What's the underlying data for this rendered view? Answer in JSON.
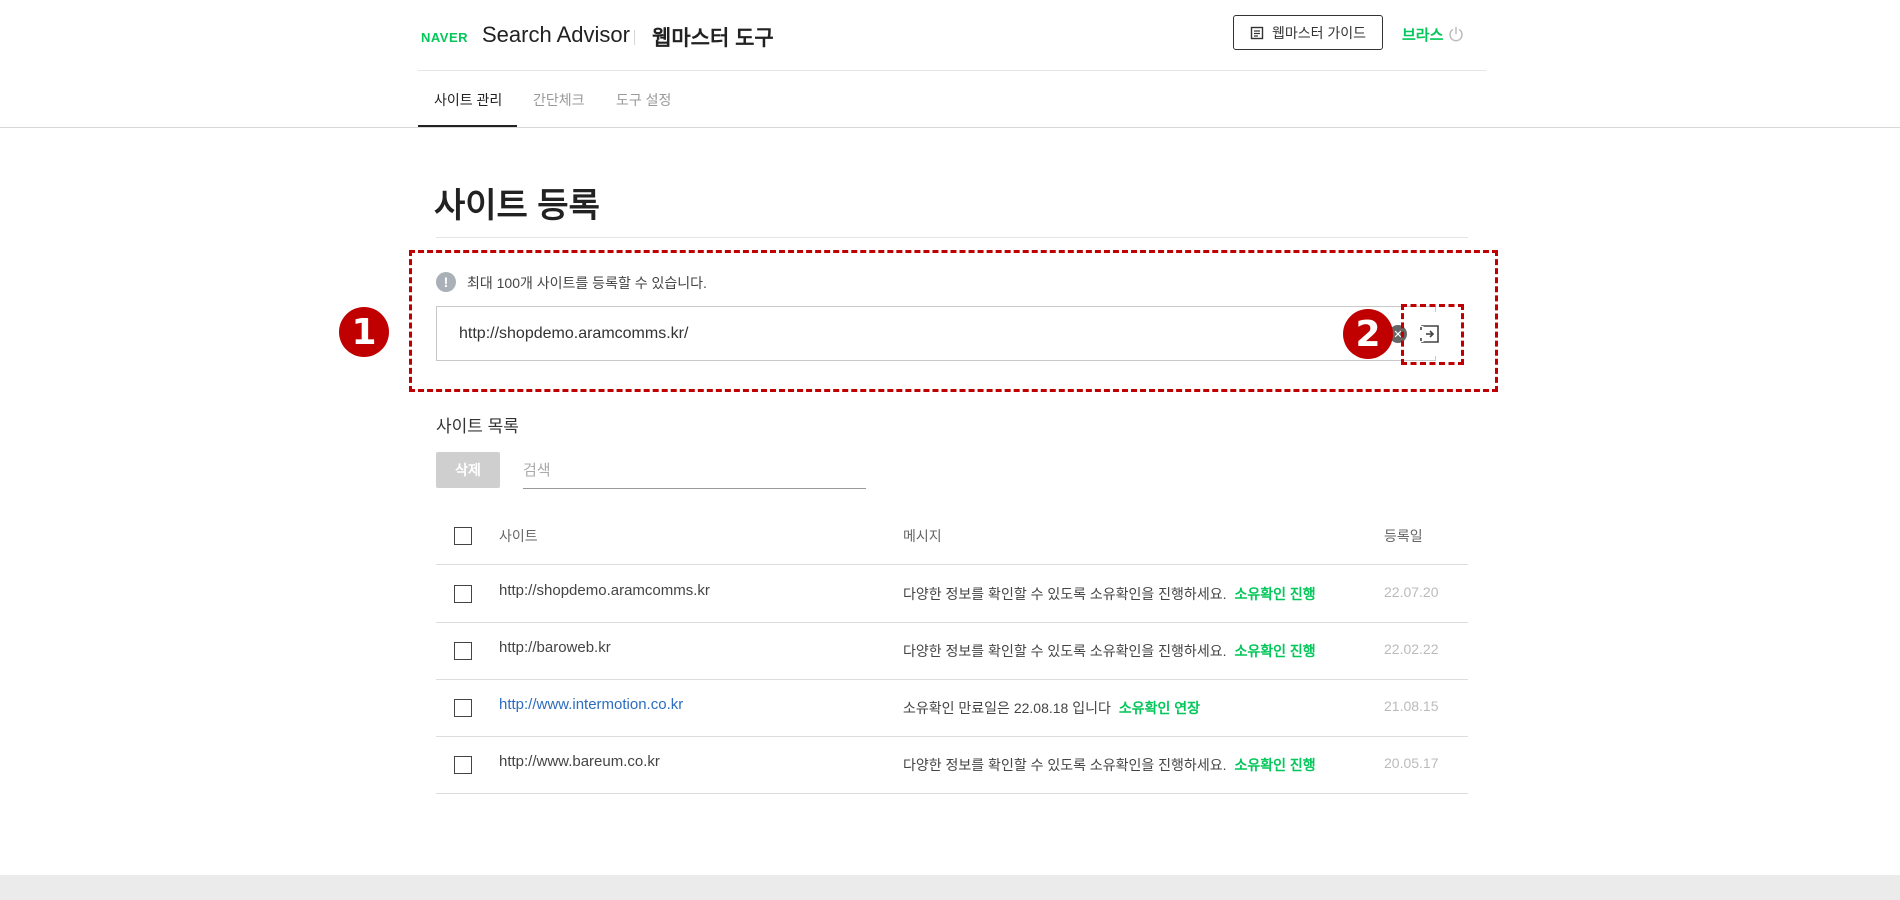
{
  "header": {
    "brand": "NAVER",
    "product": "Search Advisor",
    "tool_title": "웹마스터 도구",
    "guide_button": "웹마스터 가이드",
    "user_name": "브라스"
  },
  "tabs": [
    {
      "label": "사이트 관리",
      "active": true
    },
    {
      "label": "간단체크",
      "active": false
    },
    {
      "label": "도구 설정",
      "active": false
    }
  ],
  "main": {
    "title": "사이트 등록",
    "info_text": "최대 100개 사이트를 등록할 수 있습니다.",
    "url_value": "http://shopdemo.aramcomms.kr/"
  },
  "annotations": [
    "1",
    "2"
  ],
  "site_list": {
    "title": "사이트 목록",
    "delete_button": "삭제",
    "search_placeholder": "검색",
    "columns": [
      "사이트",
      "메시지",
      "등록일"
    ],
    "rows": [
      {
        "site": "http://shopdemo.aramcomms.kr",
        "message": "다양한 정보를 확인할 수 있도록 소유확인을 진행하세요.",
        "action": "소유확인 진행",
        "date": "22.07.20"
      },
      {
        "site": "http://baroweb.kr",
        "message": "다양한 정보를 확인할 수 있도록 소유확인을 진행하세요.",
        "action": "소유확인 진행",
        "date": "22.02.22"
      },
      {
        "site": "http://www.intermotion.co.kr",
        "message": "소유확인 만료일은 22.08.18 입니다",
        "action": "소유확인 연장",
        "date": "21.08.15"
      },
      {
        "site": "http://www.bareum.co.kr",
        "message": "다양한 정보를 확인할 수 있도록 소유확인을 진행하세요.",
        "action": "소유확인 진행",
        "date": "20.05.17"
      }
    ]
  },
  "colors": {
    "brand_green": "#03c75a",
    "annotation_red": "#c00000",
    "link_blue": "#2d6cc0"
  }
}
